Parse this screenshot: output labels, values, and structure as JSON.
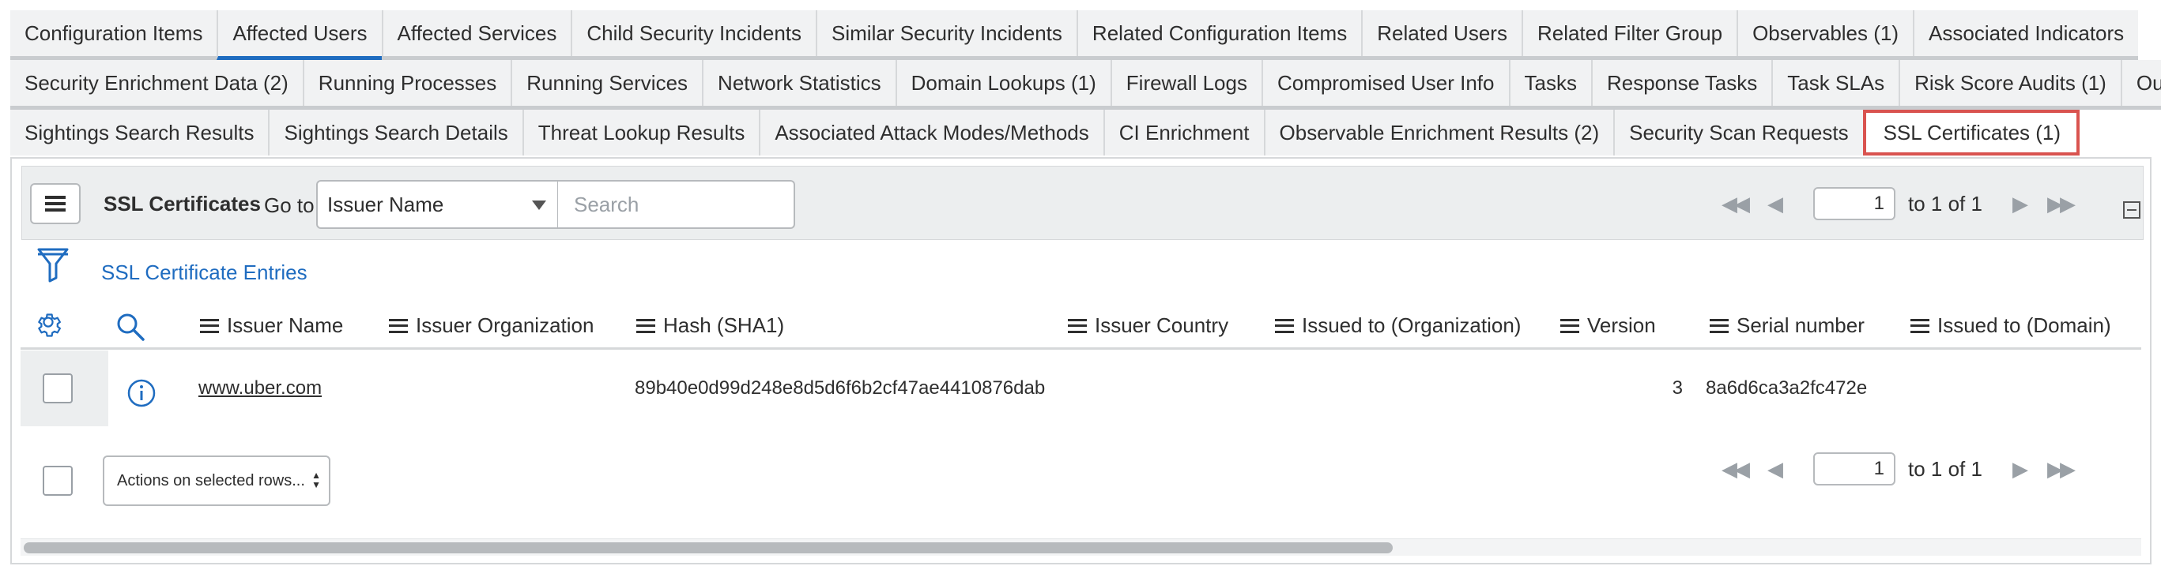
{
  "tabs": {
    "row1": [
      "Configuration Items",
      "Affected Users",
      "Affected Services",
      "Child Security Incidents",
      "Similar Security Incidents",
      "Related Configuration Items",
      "Related Users",
      "Related Filter Group",
      "Observables (1)",
      "Associated Indicators"
    ],
    "row2": [
      "Security Enrichment Data (2)",
      "Running Processes",
      "Running Services",
      "Network Statistics",
      "Domain Lookups (1)",
      "Firewall Logs",
      "Compromised User Info",
      "Tasks",
      "Response Tasks",
      "Task SLAs",
      "Risk Score Audits (1)",
      "Outages"
    ],
    "row3": [
      "Sightings Search Results",
      "Sightings Search Details",
      "Threat Lookup Results",
      "Associated Attack Modes/Methods",
      "CI Enrichment",
      "Observable Enrichment Results (2)",
      "Security Scan Requests",
      "SSL Certificates (1)"
    ]
  },
  "toolbar": {
    "title": "SSL Certificates",
    "goto_label": "Go to",
    "field_select": "Issuer Name",
    "search_placeholder": "Search"
  },
  "pager_top": {
    "page": "1",
    "range_text": "to 1 of 1"
  },
  "pager_bottom": {
    "page": "1",
    "range_text": "to 1 of 1"
  },
  "breadcrumb": "SSL Certificate Entries",
  "columns": [
    "Issuer Name",
    "Issuer Organization",
    "Hash (SHA1)",
    "Issuer Country",
    "Issued to (Organization)",
    "Version",
    "Serial number",
    "Issued to (Domain)"
  ],
  "rows": [
    {
      "issuer_name": "www.uber.com",
      "issuer_organization": "",
      "hash_sha1": "89b40e0d99d248e8d5d6f6b2cf47ae4410876dab",
      "issuer_country": "",
      "issued_to_org": "",
      "version": "3",
      "serial_number": "8a6d6ca3a2fc472e",
      "issued_to_domain": ""
    }
  ],
  "footer": {
    "actions_label": "Actions on selected rows..."
  },
  "colors": {
    "accent": "#1f6cc0",
    "highlight": "#d9534f",
    "toolbar_bg": "#eceeef"
  },
  "icons": {
    "first": "double-left-triangle-icon",
    "prev": "left-triangle-icon",
    "next": "right-triangle-icon",
    "last": "double-right-triangle-icon"
  }
}
